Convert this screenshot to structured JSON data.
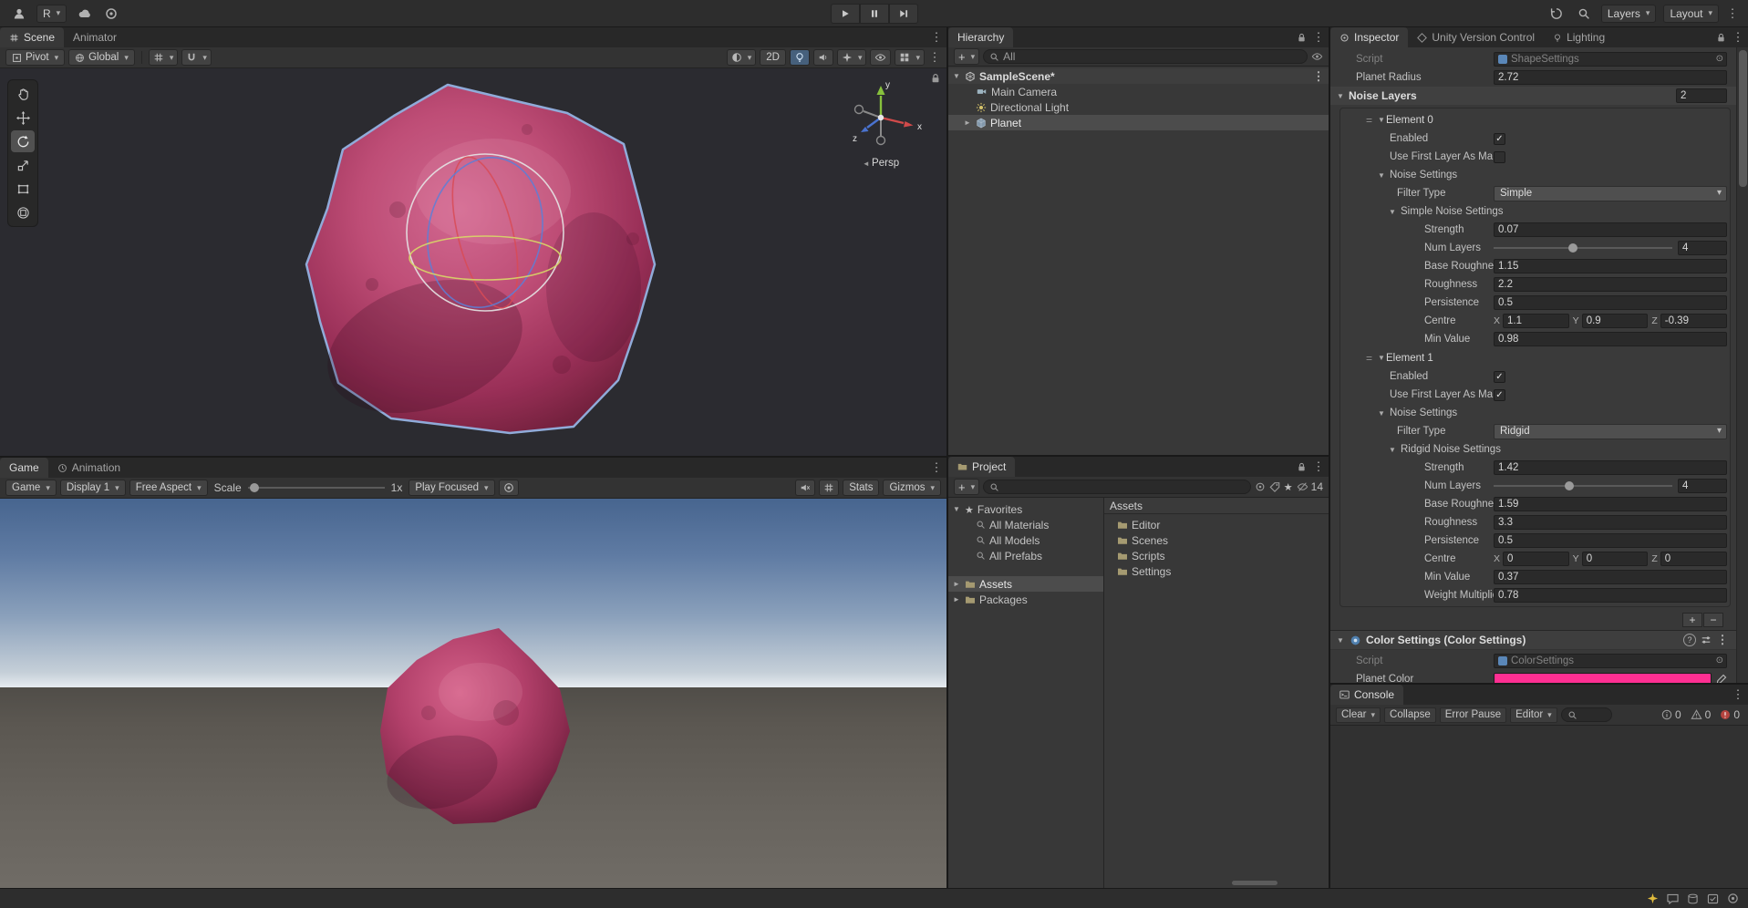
{
  "topbar": {
    "account": "R",
    "layers": "Layers",
    "layout": "Layout"
  },
  "scene": {
    "tab": "Scene",
    "tab_animator": "Animator",
    "pivot": "Pivot",
    "global": "Global",
    "two_d": "2D",
    "persp": "Persp",
    "ax": "x",
    "ay": "y",
    "az": "z"
  },
  "game": {
    "tab": "Game",
    "tab_animation": "Animation",
    "menu": "Game",
    "display": "Display 1",
    "aspect": "Free Aspect",
    "scale_label": "Scale",
    "scale_value": "1x",
    "play_focused": "Play Focused",
    "stats": "Stats",
    "gizmos": "Gizmos"
  },
  "hierarchy": {
    "tab": "Hierarchy",
    "search": "All",
    "scene_name": "SampleScene*",
    "items": [
      {
        "label": "Main Camera"
      },
      {
        "label": "Directional Light"
      },
      {
        "label": "Planet"
      }
    ]
  },
  "project": {
    "tab": "Project",
    "favorites": "Favorites",
    "fav_items": [
      {
        "label": "All Materials"
      },
      {
        "label": "All Models"
      },
      {
        "label": "All Prefabs"
      }
    ],
    "roots": [
      {
        "label": "Assets"
      },
      {
        "label": "Packages"
      }
    ],
    "breadcrumb": "Assets",
    "folders": [
      {
        "label": "Editor"
      },
      {
        "label": "Scenes"
      },
      {
        "label": "Scripts"
      },
      {
        "label": "Settings"
      }
    ],
    "hidden_count": "14"
  },
  "inspector": {
    "tab": "Inspector",
    "tab_vcs": "Unity Version Control",
    "tab_lighting": "Lighting",
    "script_label": "Script",
    "shape_script": "ShapeSettings",
    "radius_label": "Planet Radius",
    "radius_value": "2.72",
    "noise_layers_label": "Noise Layers",
    "noise_layers_size": "2",
    "vx": "X",
    "vy": "Y",
    "vz": "Z",
    "elements": [
      {
        "title": "Element 0",
        "enabled_label": "Enabled",
        "mask_label": "Use First Layer As Ma",
        "noise_settings_label": "Noise Settings",
        "filter_type_label": "Filter Type",
        "filter_type": "Simple",
        "sub_header": "Simple Noise Settings",
        "strength_label": "Strength",
        "strength": "0.07",
        "num_layers_label": "Num Layers",
        "num_layers": "4",
        "base_roughness_label": "Base Roughness",
        "base_roughness": "1.15",
        "roughness_label": "Roughness",
        "roughness": "2.2",
        "persistence_label": "Persistence",
        "persistence": "0.5",
        "centre_label": "Centre",
        "cx": "1.1",
        "cy": "0.9",
        "cz": "-0.39",
        "min_value_label": "Min Value",
        "min_value": "0.98"
      },
      {
        "title": "Element 1",
        "enabled_label": "Enabled",
        "mask_label": "Use First Layer As Ma",
        "noise_settings_label": "Noise Settings",
        "filter_type_label": "Filter Type",
        "filter_type": "Ridgid",
        "sub_header": "Ridgid Noise Settings",
        "strength_label": "Strength",
        "strength": "1.42",
        "num_layers_label": "Num Layers",
        "num_layers": "4",
        "base_roughness_label": "Base Roughness",
        "base_roughness": "1.59",
        "roughness_label": "Roughness",
        "roughness": "3.3",
        "persistence_label": "Persistence",
        "persistence": "0.5",
        "centre_label": "Centre",
        "cx": "0",
        "cy": "0",
        "cz": "0",
        "min_value_label": "Min Value",
        "min_value": "0.37",
        "weight_label": "Weight Multiplier",
        "weight": "0.78"
      }
    ],
    "color_header": "Color Settings (Color Settings)",
    "color_script": "ColorSettings",
    "planet_color_label": "Planet Color",
    "planet_color": "#ff2f92"
  },
  "console": {
    "tab": "Console",
    "clear": "Clear",
    "collapse": "Collapse",
    "error_pause": "Error Pause",
    "editor": "Editor",
    "info_count": "0",
    "warn_count": "0",
    "error_count": "0"
  }
}
